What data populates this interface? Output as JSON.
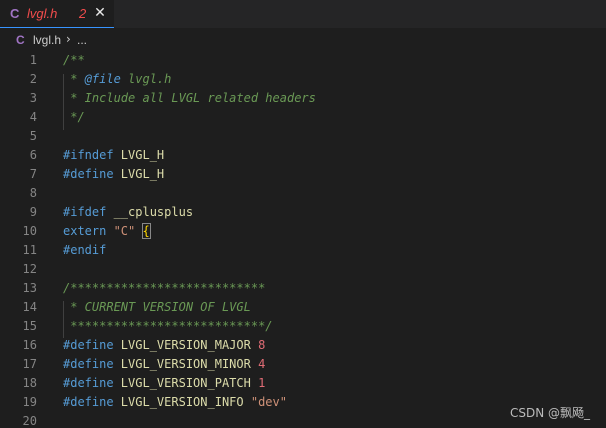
{
  "tab": {
    "icon": "C",
    "icon_name": "c-file-icon",
    "name": "lvgl.h",
    "problem_count": "2",
    "close_glyph": "✕"
  },
  "breadcrumb": {
    "icon": "C",
    "file": "lvgl.h",
    "chevron": "›",
    "more": "..."
  },
  "colors": {
    "background": "#1e1e1e",
    "tab_error": "#f14c4c",
    "keyword": "#569cd6",
    "comment": "#6a9955",
    "macro": "#dcdcaa",
    "number": "#e06c75",
    "string": "#ce9178"
  },
  "code": {
    "line_numbers": [
      "1",
      "2",
      "3",
      "4",
      "5",
      "6",
      "7",
      "8",
      "9",
      "10",
      "11",
      "12",
      "13",
      "14",
      "15",
      "16",
      "17",
      "18",
      "19",
      "20"
    ],
    "lines": {
      "l1": "/**",
      "l2_star": " * ",
      "l2_tag": "@file",
      "l2_rest": " lvgl.h",
      "l3": " * Include all LVGL related headers",
      "l4": " */",
      "l6_kw": "#ifndef",
      "l6_id": " LVGL_H",
      "l7_kw": "#define",
      "l7_id": " LVGL_H",
      "l9_kw": "#ifdef",
      "l9_id": " __cplusplus",
      "l10_kw": "extern",
      "l10_str": " \"C\"",
      "l10_brace": "{",
      "l11_kw": "#endif",
      "l13": "/***************************",
      "l14": " * CURRENT VERSION OF LVGL",
      "l15": " ***************************/",
      "l16_kw": "#define",
      "l16_id": " LVGL_VERSION_MAJOR",
      "l16_val": " 8",
      "l17_kw": "#define",
      "l17_id": " LVGL_VERSION_MINOR",
      "l17_val": " 4",
      "l18_kw": "#define",
      "l18_id": " LVGL_VERSION_PATCH",
      "l18_val": " 1",
      "l19_kw": "#define",
      "l19_id": " LVGL_VERSION_INFO",
      "l19_val": " \"dev\""
    }
  },
  "watermark": "CSDN @飘飏_"
}
